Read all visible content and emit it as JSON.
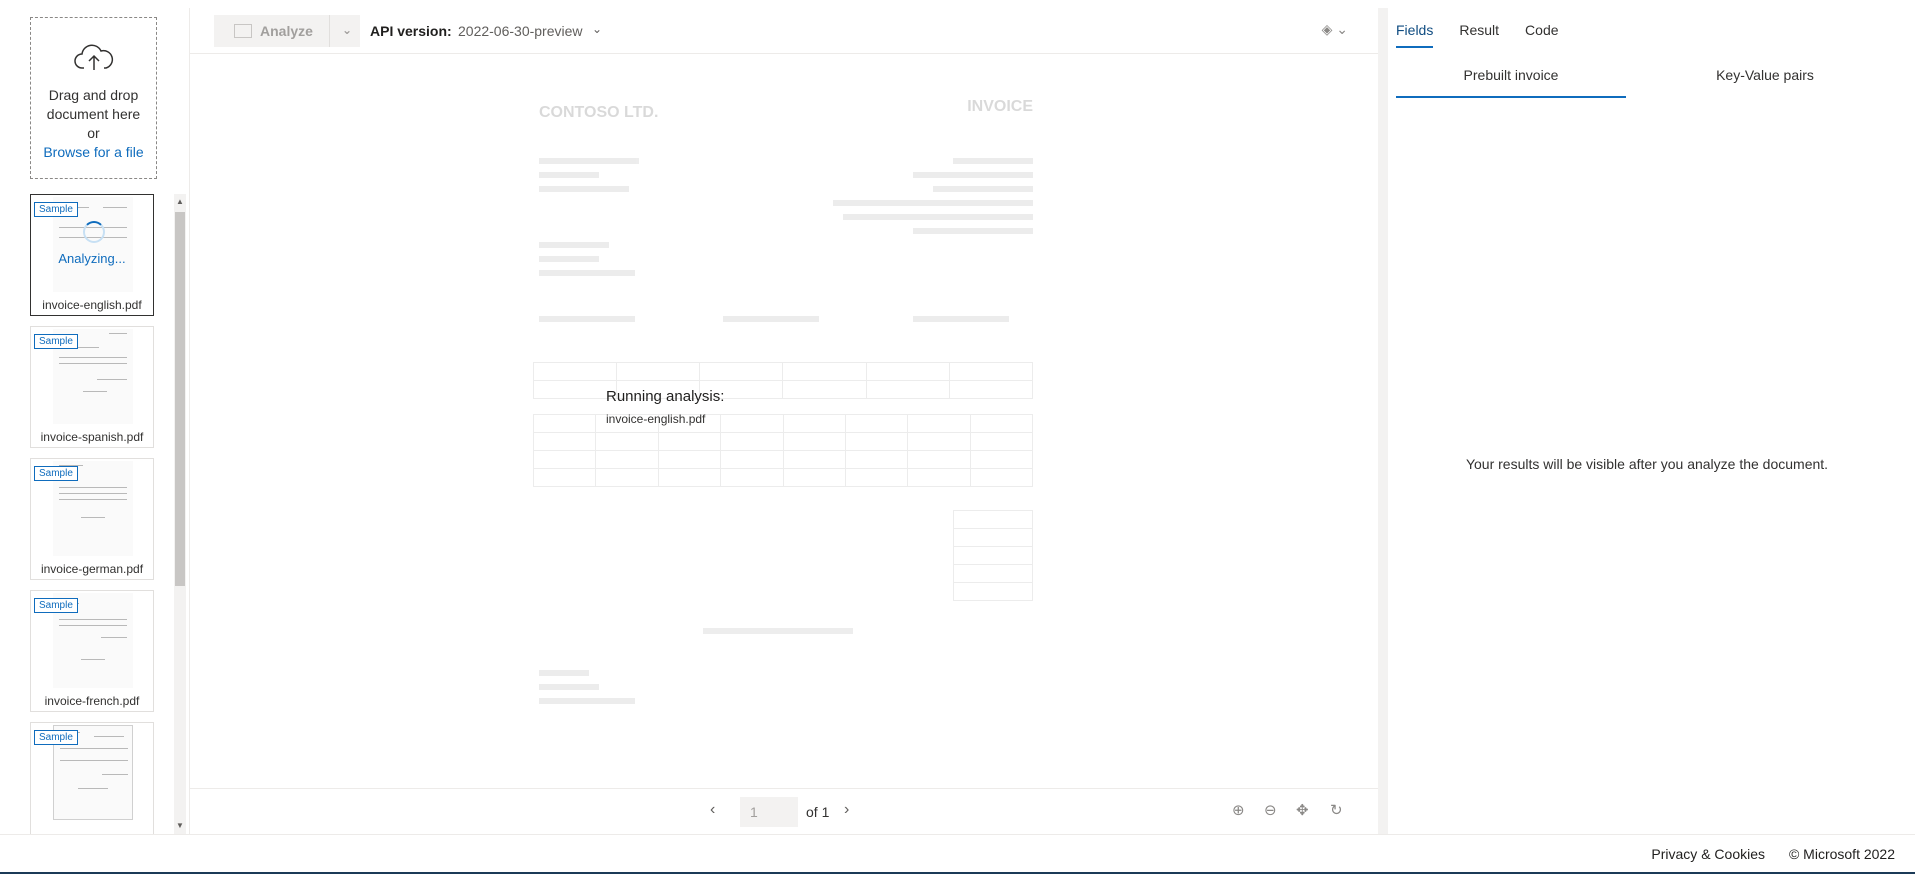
{
  "sidebar": {
    "dropzone": {
      "line1": "Drag and drop document here",
      "line2": "or",
      "browse": "Browse for a file"
    },
    "thumbnails": [
      {
        "badge": "Sample",
        "name": "invoice-english.pdf",
        "status": "Analyzing..."
      },
      {
        "badge": "Sample",
        "name": "invoice-spanish.pdf"
      },
      {
        "badge": "Sample",
        "name": "invoice-german.pdf"
      },
      {
        "badge": "Sample",
        "name": "invoice-french.pdf"
      },
      {
        "badge": "Sample",
        "name": ""
      }
    ]
  },
  "toolbar": {
    "analyze_label": "Analyze",
    "api_version_label": "API version:",
    "api_version_value": "2022-06-30-preview"
  },
  "document": {
    "company": "CONTOSO LTD.",
    "doc_type": "INVOICE"
  },
  "overlay": {
    "title": "Running analysis:",
    "file": "invoice-english.pdf"
  },
  "pager": {
    "page": "1",
    "of_label": "of 1"
  },
  "right_panel": {
    "tabs": [
      {
        "label": "Fields"
      },
      {
        "label": "Result"
      },
      {
        "label": "Code"
      }
    ],
    "subtabs": [
      {
        "label": "Prebuilt invoice"
      },
      {
        "label": "Key-Value pairs"
      }
    ],
    "empty_message": "Your results will be visible after you analyze the document."
  },
  "footer": {
    "privacy": "Privacy & Cookies",
    "copyright": "© Microsoft 2022"
  },
  "colors": {
    "accent": "#0f6cbd",
    "footer_bar": "#1b3a57"
  }
}
